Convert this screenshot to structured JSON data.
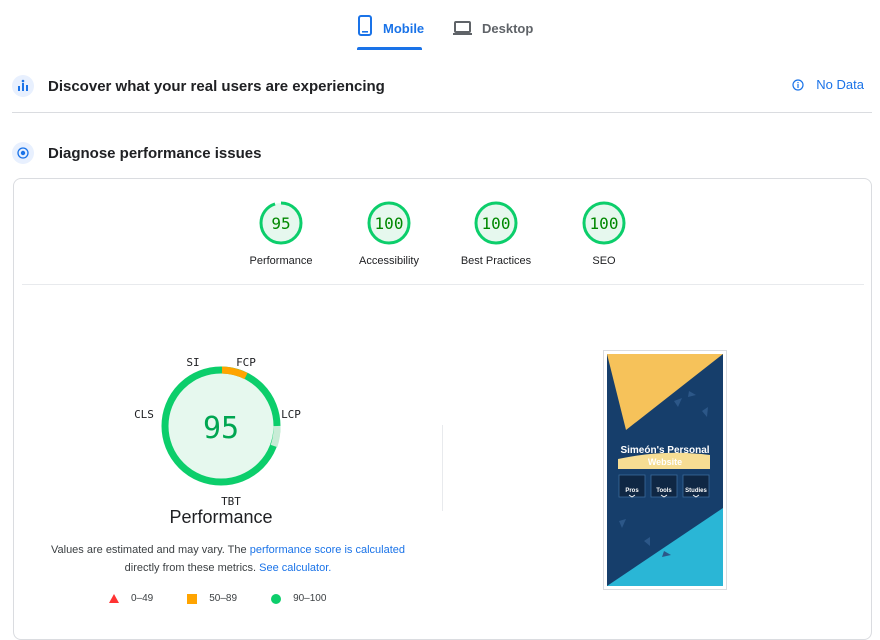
{
  "tabs": {
    "mobile_label": "Mobile",
    "desktop_label": "Desktop"
  },
  "field_data": {
    "title": "Discover what your real users are experiencing",
    "no_data_label": "No Data"
  },
  "diagnose": {
    "title": "Diagnose performance issues"
  },
  "category_scores": [
    {
      "label": "Performance",
      "score": "95",
      "value": 95
    },
    {
      "label": "Accessibility",
      "score": "100",
      "value": 100
    },
    {
      "label": "Best Practices",
      "score": "100",
      "value": 100
    },
    {
      "label": "SEO",
      "score": "100",
      "value": 100
    }
  ],
  "performance": {
    "score": "95",
    "title": "Performance",
    "metrics": {
      "si": "SI",
      "fcp": "FCP",
      "lcp": "LCP",
      "tbt": "TBT",
      "cls": "CLS"
    },
    "note_prefix": "Values are estimated and may vary. The ",
    "note_link1": "performance score is calculated",
    "note_middle": "directly from these metrics. ",
    "note_link2": "See calculator."
  },
  "legend": {
    "fail": "0–49",
    "average": "50–89",
    "pass": "90–100"
  },
  "screenshot": {
    "site_title_line1": "Simeón's Personal",
    "site_title_line2": "Website",
    "nav_items": [
      "Pros",
      "Tools",
      "Studies"
    ]
  },
  "colors": {
    "accent": "#1a73e8",
    "pass": "#0cce6b",
    "pass_text": "#008800",
    "pass_fill": "#e6f8ee",
    "average": "#ffa400",
    "fail": "#ff3333"
  }
}
